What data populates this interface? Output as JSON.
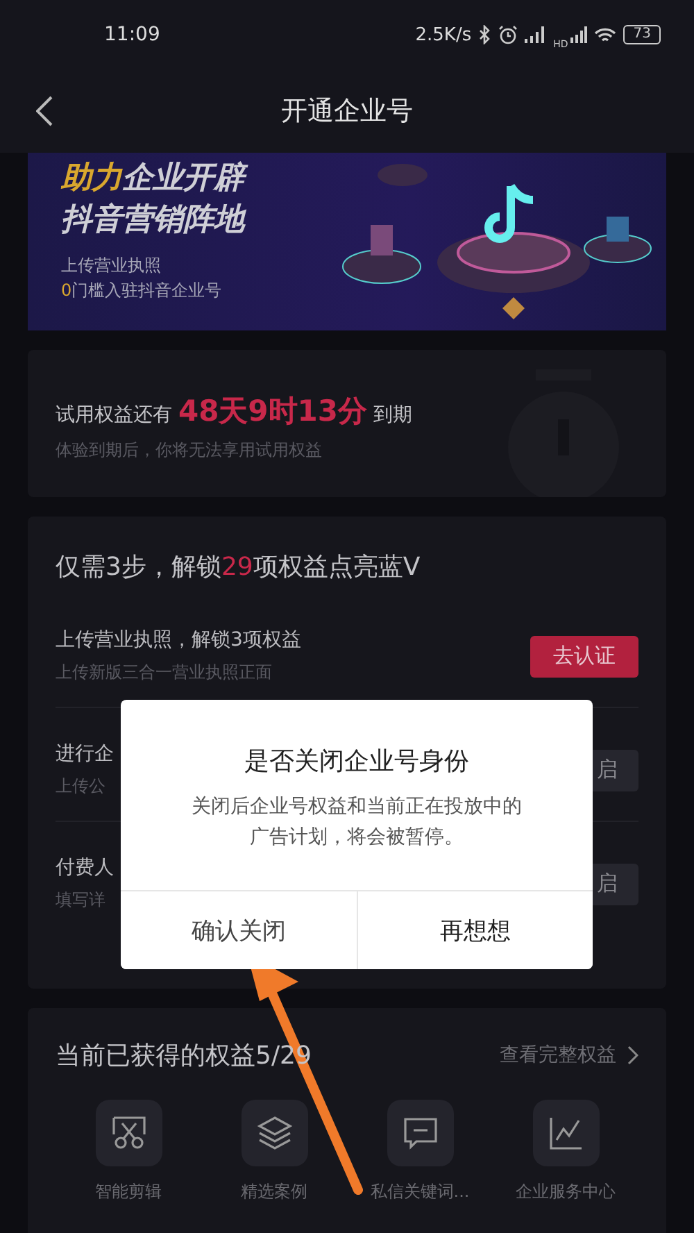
{
  "status_bar": {
    "time": "11:09",
    "speed": "2.5K/s",
    "network_label": "HD",
    "battery": "73"
  },
  "nav": {
    "title": "开通企业号"
  },
  "banner": {
    "headline_highlight": "助力",
    "headline_rest": "企业开辟",
    "headline_line2": "抖音营销阵地",
    "subtitle": "上传营业执照",
    "subtitle_highlight": "0",
    "subtitle_rest": "门槛入驻抖音企业号"
  },
  "trial": {
    "prefix": "试用权益还有",
    "countdown": "48天9时13分",
    "suffix": "到期",
    "note": "体验到期后，你将无法享用试用权益"
  },
  "steps": {
    "title_prefix": "仅需3步，解锁",
    "title_count": "29",
    "title_suffix": "项权益点亮蓝V",
    "items": [
      {
        "title": "上传营业执照，解锁3项权益",
        "subtitle": "上传新版三合一营业执照正面",
        "button": "去认证",
        "kind": "primary"
      },
      {
        "title": "进行企",
        "subtitle": "上传公",
        "button": "启",
        "kind": "secondary"
      },
      {
        "title": "付费人",
        "subtitle": "填写详",
        "button": "启",
        "kind": "secondary"
      }
    ]
  },
  "benefits": {
    "title": "当前已获得的权益5/29",
    "link": "查看完整权益",
    "items": [
      {
        "label": "智能剪辑"
      },
      {
        "label": "精选案例"
      },
      {
        "label": "私信关键词..."
      },
      {
        "label": "企业服务中心"
      }
    ]
  },
  "dialog": {
    "title": "是否关闭企业号身份",
    "message": "关闭后企业号权益和当前正在投放中的广告计划，将会被暂停。",
    "buttons": [
      "确认关闭",
      "再想想"
    ]
  }
}
